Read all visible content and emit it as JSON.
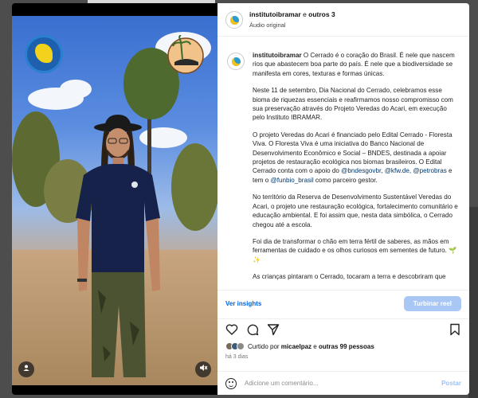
{
  "header": {
    "username": "institutoibramar",
    "conj": " e ",
    "others": "outros 3",
    "audio": "Áudio original"
  },
  "caption": {
    "username": "institutoibramar",
    "p1": " O Cerrado é o coração do Brasil. É nele que nascem rios que abastecem boa parte do país. É nele que a biodiversidade se manifesta em cores, texturas e formas únicas.",
    "p2": "Neste 11 de setembro, Dia Nacional do Cerrado, celebramos esse bioma de riquezas essenciais e reafirmamos nosso compromisso com sua preservação através do Projeto Veredas do Acari, em execução pelo Instituto IBRAMAR.",
    "p3a": "O projeto Veredas do Acari é financiado pelo Edital Cerrado - Floresta Viva. O Floresta Viva é uma iniciativa do Banco Nacional de Desenvolvimento Econômico e Social – BNDES, destinada a apoiar projetos de restauração ecológica nos biomas brasileiros. O Edital Cerrado conta com o apoio do ",
    "tag1": "@bndesgovbr",
    "sep1": ", ",
    "tag2": "@kfw.de",
    "sep2": ", ",
    "tag3": "@petrobras",
    "p3b": " e tem o ",
    "tag4": "@funbio_brasil",
    "p3c": " como parceiro gestor.",
    "p4": "No território da Reserva de Desenvolvimento Sustentável Veredas do Acari, o projeto une restauração ecológica, fortalecimento comunitário e educação ambiental. E foi assim que, nesta data simbólica, o Cerrado chegou até a escola.",
    "p5": "Foi dia de transformar o chão em terra fértil de saberes, as mãos em ferramentas de cuidado e os olhos curiosos em sementes de futuro. 🌱✨",
    "p6": "As crianças pintaram o Cerrado, tocaram a terra e descobriram que"
  },
  "insights": {
    "link": "Ver insights",
    "boost": "Turbinar reel"
  },
  "likes": {
    "prefix": "Curtido por ",
    "user": "micaelpaz",
    "mid": " e ",
    "others": "outras 99 pessoas"
  },
  "time_ago": "há 3 dias",
  "comment": {
    "placeholder": "Adicione um comentário...",
    "post": "Postar"
  },
  "icons": {
    "like": "heart-icon",
    "comment": "comment-icon",
    "share": "send-icon",
    "save": "bookmark-icon",
    "user": "user-icon",
    "mute": "muted-speaker-icon",
    "emoji": "emoji-icon"
  },
  "colors": {
    "link": "#0064e0",
    "boost_bg": "#a9c7f5",
    "post": "#9cc1f4",
    "tag": "#00376b"
  }
}
